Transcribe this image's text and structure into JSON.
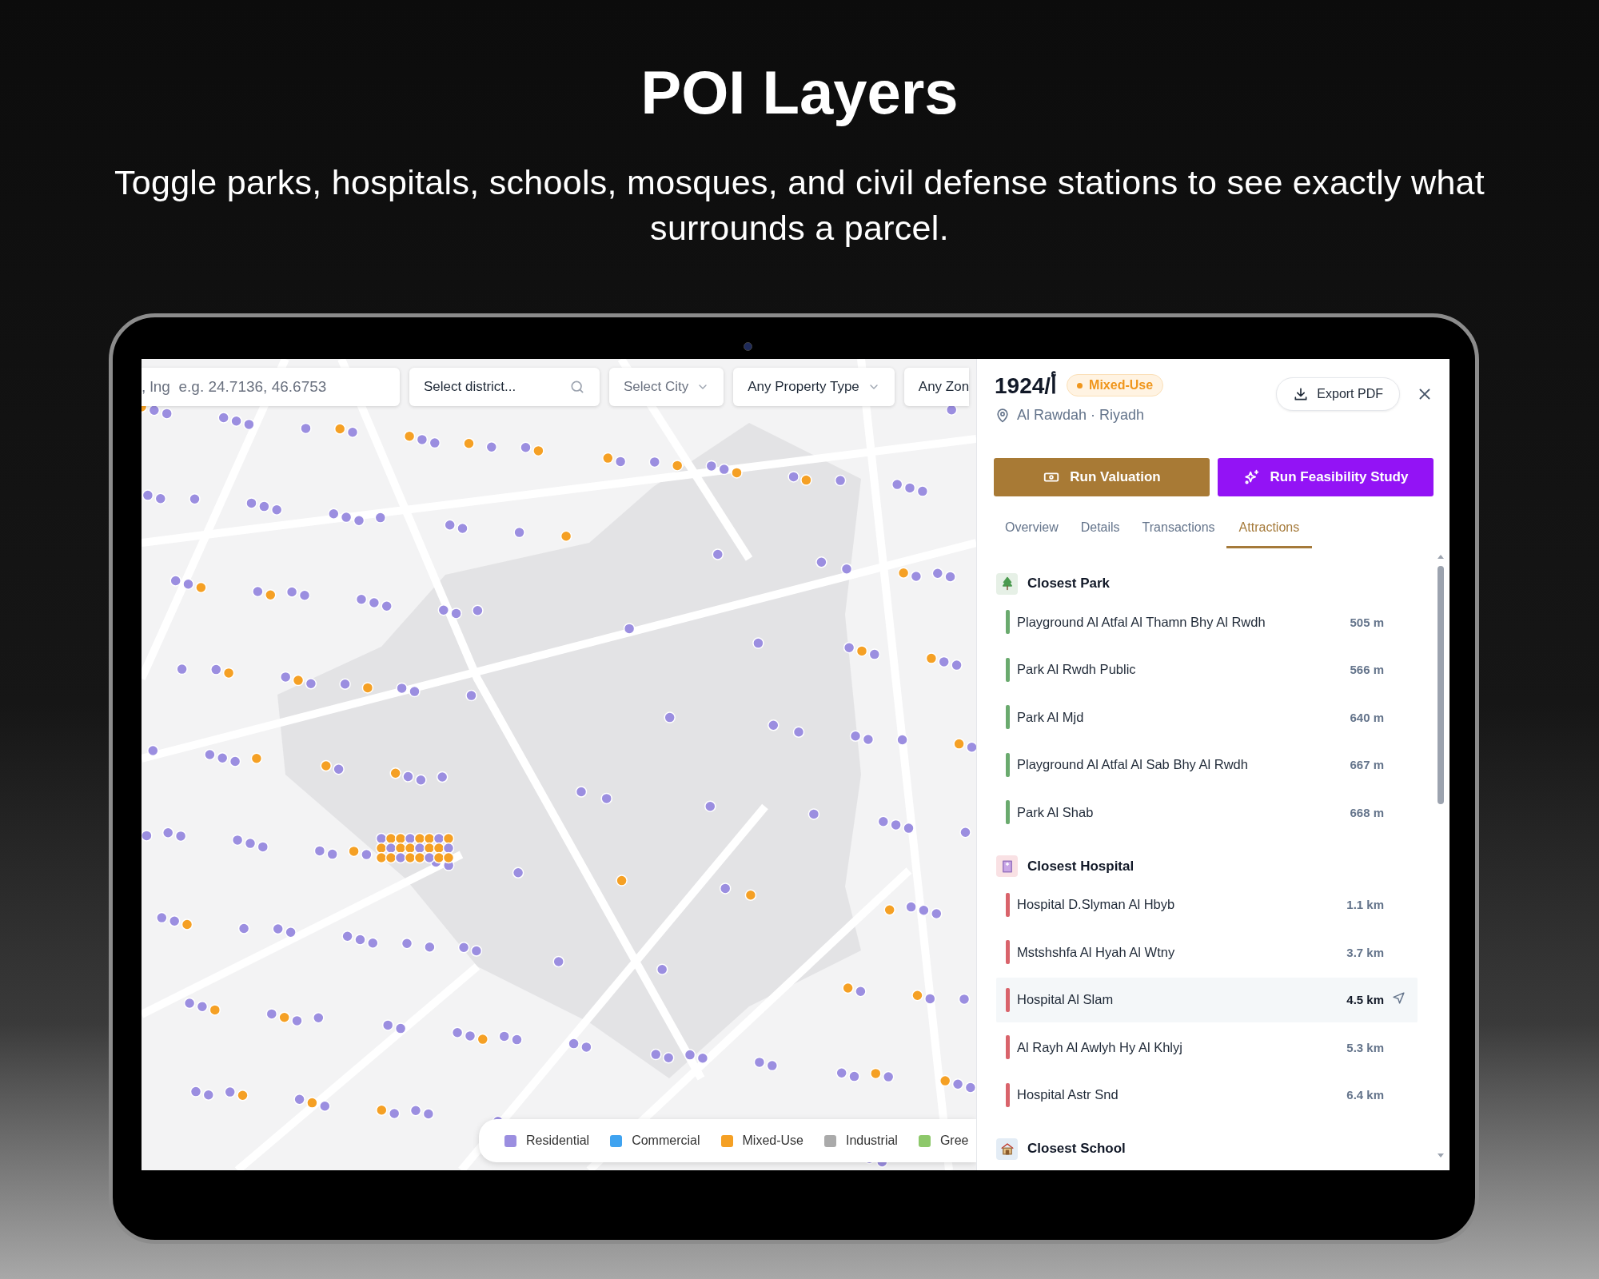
{
  "heading": {
    "title": "POI Layers",
    "subtitle": "Toggle parks, hospitals, schools, mosques, and civil defense stations to see exactly what surrounds a parcel."
  },
  "map": {
    "filters": [
      {
        "kind": "input",
        "placeholder": ", lng  e.g. 24.7136, 46.6753"
      },
      {
        "kind": "search",
        "placeholder": "Select district..."
      },
      {
        "kind": "select",
        "placeholder": "Select City"
      },
      {
        "kind": "select",
        "value": "Any Property Type"
      },
      {
        "kind": "partial",
        "value": "Any Zon"
      }
    ],
    "legend": [
      {
        "label": "Residential",
        "color": "#9b8ee0"
      },
      {
        "label": "Commercial",
        "color": "#3fa3f0"
      },
      {
        "label": "Mixed-Use",
        "color": "#f5a024"
      },
      {
        "label": "Industrial",
        "color": "#aaaaaa"
      },
      {
        "label": "Gree",
        "color": "#8dc86a"
      }
    ]
  },
  "panel": {
    "title": "1924/أ",
    "badge": "Mixed-Use",
    "location": "Al Rawdah · Riyadh",
    "export": "Export PDF",
    "actions": [
      {
        "kind": "valuation",
        "label": "Run Valuation"
      },
      {
        "kind": "feasibility",
        "label": "Run Feasibility Study"
      }
    ],
    "tabs": [
      {
        "label": "Overview",
        "selected": false
      },
      {
        "label": "Details",
        "selected": false
      },
      {
        "label": "Transactions",
        "selected": false
      },
      {
        "label": "Attractions",
        "selected": true
      }
    ],
    "sections": [
      {
        "kind": "park",
        "title": "Closest Park",
        "color": "#6aaa6e",
        "items": [
          {
            "name": "Playground Al Atfal Al Thamn Bhy Al Rwdh",
            "distance": "505 m",
            "selected": false
          },
          {
            "name": "Park Al Rwdh Public",
            "distance": "566 m",
            "selected": false
          },
          {
            "name": "Park Al Mjd",
            "distance": "640 m",
            "selected": false
          },
          {
            "name": "Playground Al Atfal Al Sab Bhy Al Rwdh",
            "distance": "667 m",
            "selected": false
          },
          {
            "name": "Park Al Shab",
            "distance": "668 m",
            "selected": false
          }
        ]
      },
      {
        "kind": "hospital",
        "title": "Closest Hospital",
        "color": "#d9636b",
        "items": [
          {
            "name": "Hospital D.Slyman Al Hbyb",
            "distance": "1.1 km",
            "selected": false
          },
          {
            "name": "Mstshshfa Al Hyah Al Wtny",
            "distance": "3.7 km",
            "selected": false
          },
          {
            "name": "Hospital Al Slam",
            "distance": "4.5 km",
            "selected": true
          },
          {
            "name": "Al Rayh Al Awlyh Hy Al Khlyj",
            "distance": "5.3 km",
            "selected": false
          },
          {
            "name": "Hospital Astr Snd",
            "distance": "6.4 km",
            "selected": false
          }
        ]
      },
      {
        "kind": "school",
        "title": "Closest School"
      }
    ]
  }
}
